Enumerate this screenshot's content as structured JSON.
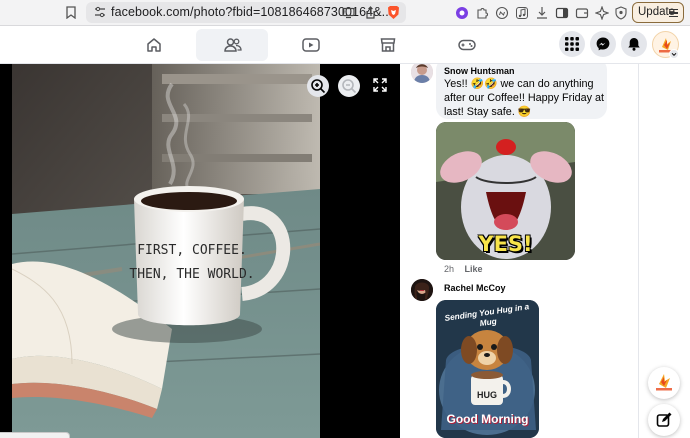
{
  "browser": {
    "url": "facebook.com/photo?fbid=1081864687300164&...",
    "update_label": "Update"
  },
  "nav": {
    "tabs": [
      {
        "name": "Home",
        "icon": "home-icon"
      },
      {
        "name": "Friends",
        "icon": "friends-icon",
        "active": true
      },
      {
        "name": "Video",
        "icon": "video-icon"
      },
      {
        "name": "Marketplace",
        "icon": "marketplace-icon"
      },
      {
        "name": "Gaming",
        "icon": "gaming-icon"
      }
    ],
    "right_icons": [
      "menu-grid-icon",
      "messenger-icon",
      "notifications-bell-icon",
      "profile-avatar"
    ]
  },
  "photo": {
    "mug_text_line1": "FIRST, COFFEE.",
    "mug_text_line2": "THEN, THE WORLD.",
    "controls": [
      "zoom-in-icon",
      "zoom-out-icon",
      "fullscreen-icon"
    ]
  },
  "comments": [
    {
      "author": "Snow Huntsman",
      "text_line1": "Yes!! 🤣🤣 we can do anything",
      "text_line2": "after our Coffee!! Happy Friday at",
      "text_line3": "last! Stay safe. 😎",
      "gif_caption": "YES!",
      "time": "2h",
      "like_label": "Like"
    },
    {
      "author": "Rachel McCoy",
      "gif_top_text": "Sending You Hug in a Mug",
      "gif_mug_text": "HUG",
      "gif_bottom_text": "Good Morning"
    }
  ],
  "colors": {
    "facebook_blue": "#0866ff",
    "bubble_bg": "#f0f2f5",
    "brave_orange": "#fb542b",
    "update_border": "#8a6b3b"
  }
}
